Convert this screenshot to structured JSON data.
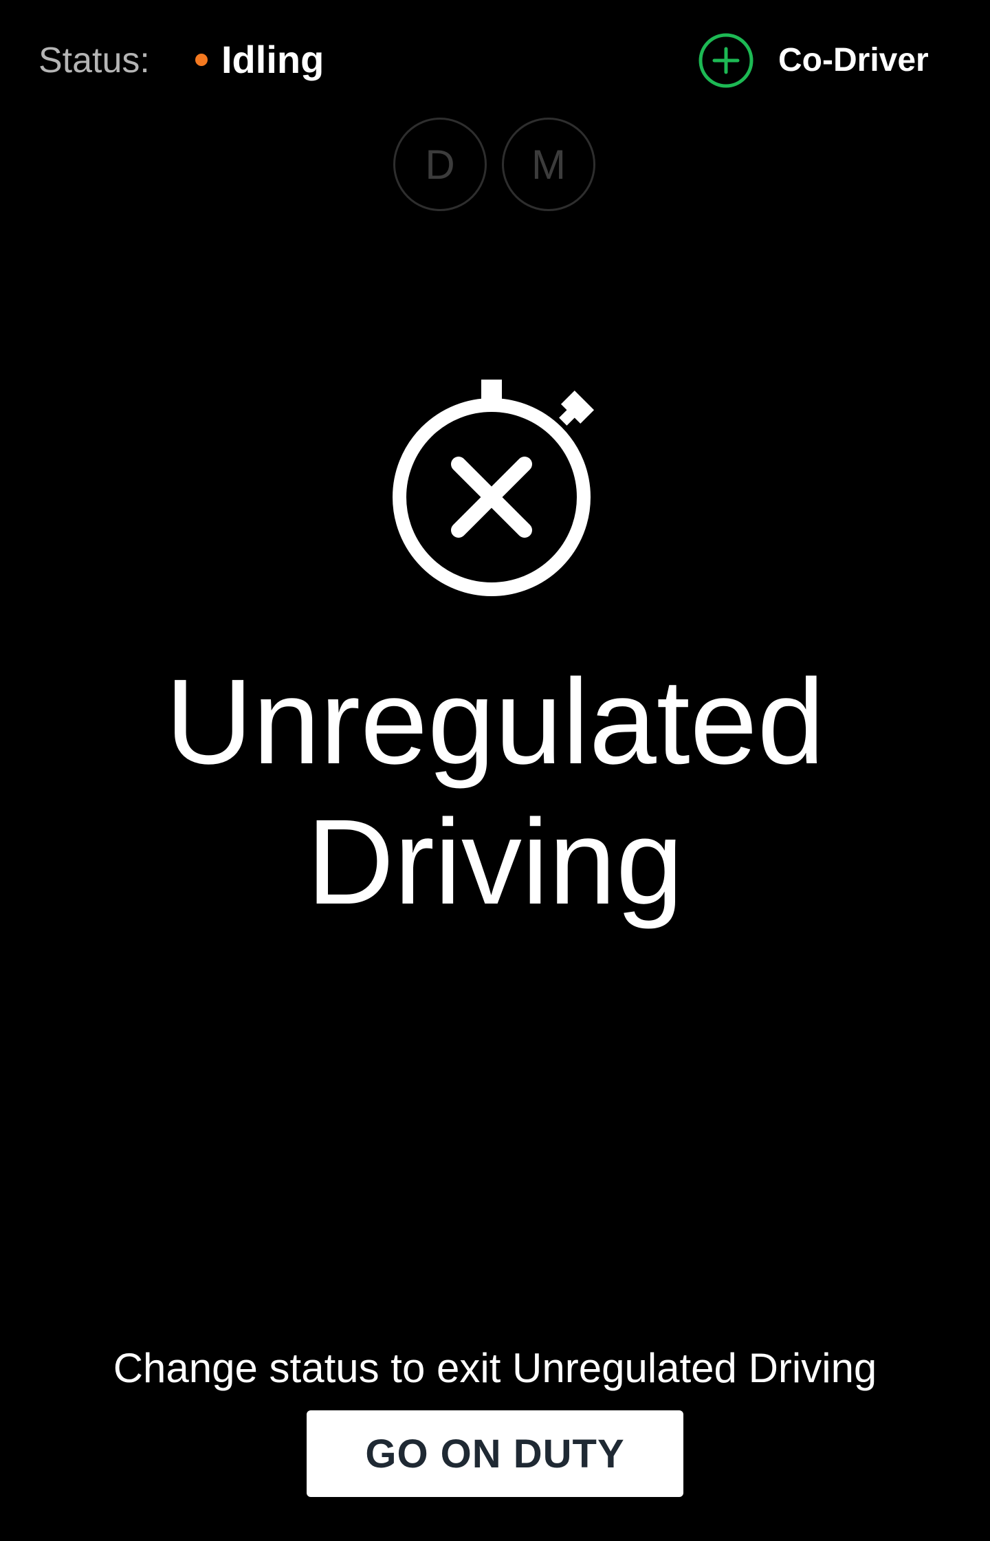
{
  "status": {
    "label": "Status:",
    "value": "Idling",
    "dot_color": "#f47920"
  },
  "codriver": {
    "icon": "plus-circle-icon",
    "icon_color": "#1db954",
    "label": "Co-Driver"
  },
  "modes": [
    {
      "label": "D"
    },
    {
      "label": "M"
    }
  ],
  "main": {
    "icon": "stopwatch-cancel-icon",
    "heading_line1": "Unregulated",
    "heading_line2": "Driving"
  },
  "footer": {
    "instruction": "Change status to exit Unregulated Driving",
    "button_label": "GO ON DUTY"
  }
}
